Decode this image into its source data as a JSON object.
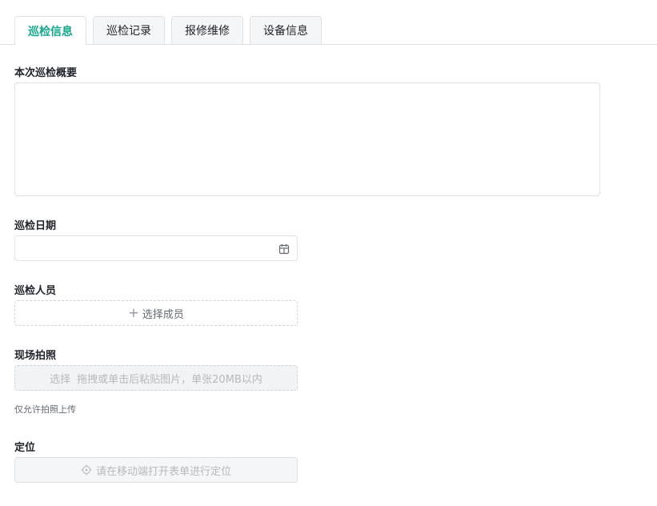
{
  "tabs": [
    {
      "label": "巡检信息",
      "active": true
    },
    {
      "label": "巡检记录",
      "active": false
    },
    {
      "label": "报修维修",
      "active": false
    },
    {
      "label": "设备信息",
      "active": false
    }
  ],
  "colors": {
    "accent": "#14a88b",
    "border": "#dee0e3",
    "disabled_text": "#b6b9be"
  },
  "form": {
    "summary": {
      "label": "本次巡检概要",
      "value": ""
    },
    "date": {
      "label": "巡检日期",
      "value": "",
      "icon": "calendar-icon"
    },
    "inspector": {
      "label": "巡检人员",
      "button": "选择成员",
      "icon": "plus-icon"
    },
    "photos": {
      "label": "现场拍照",
      "pick": "选择",
      "drop": "拖拽或单击后粘贴图片，单张20MB以内",
      "hint": "仅允许拍照上传"
    },
    "location": {
      "label": "定位",
      "text": "请在移动端打开表单进行定位",
      "icon": "locate-icon"
    }
  }
}
